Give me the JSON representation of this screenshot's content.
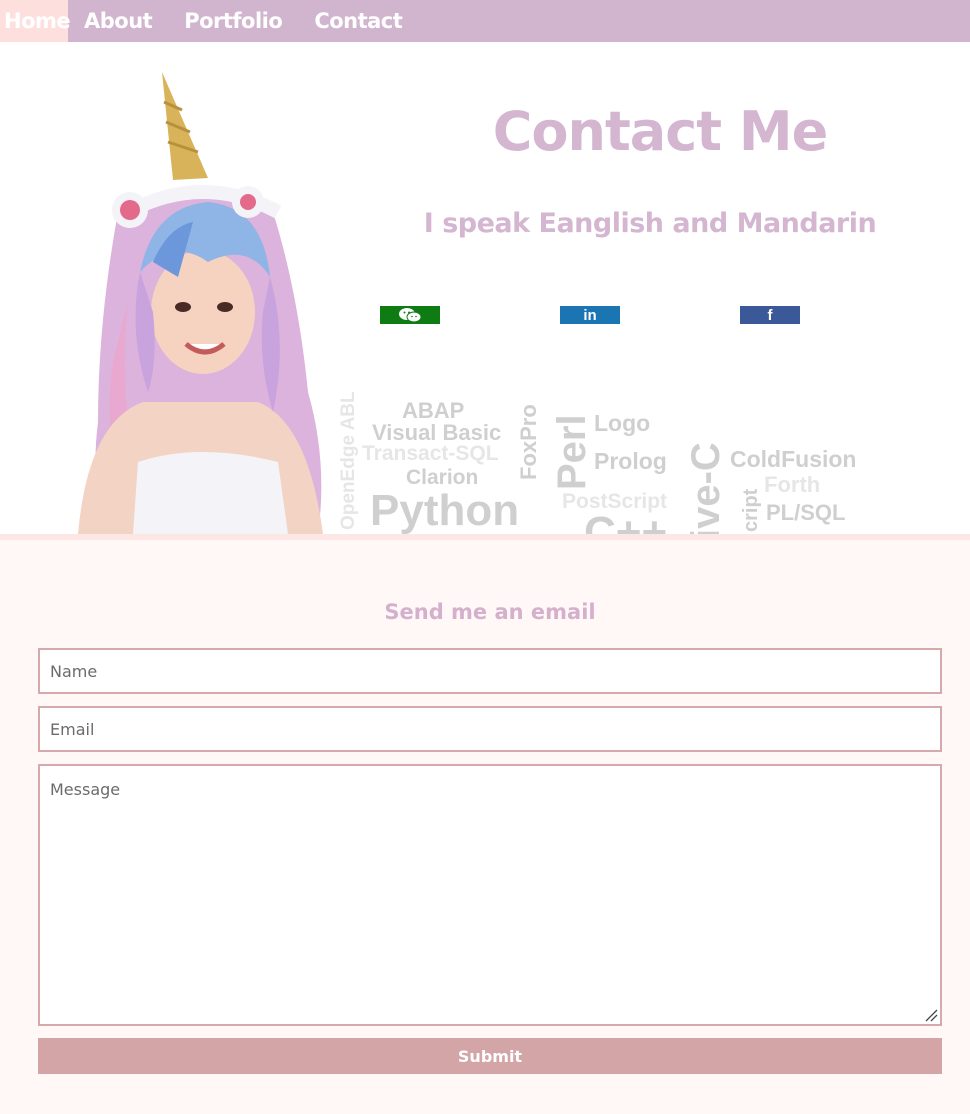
{
  "nav": {
    "items": [
      {
        "label": "Home",
        "active": true
      },
      {
        "label": "About",
        "active": false
      },
      {
        "label": "Portfolio",
        "active": false
      },
      {
        "label": "Contact",
        "active": false
      }
    ]
  },
  "hero": {
    "title": "Contact Me",
    "subtitle": "I speak Eanglish and Mandarin",
    "social": [
      {
        "name": "wechat-icon",
        "color": "#0f7c13"
      },
      {
        "name": "linkedin-icon",
        "glyph": "in",
        "color": "#1a75b2"
      },
      {
        "name": "facebook-icon",
        "glyph": "f",
        "color": "#3b5998"
      }
    ],
    "word_cloud": [
      "ABAP",
      "Visual Basic",
      "Transact-SQL",
      "Clarion",
      "Python",
      "FoxPro",
      "Perl",
      "Logo",
      "Prolog",
      "PostScript",
      "ive-C",
      "ColdFusion",
      "Forth",
      "PL/SQL",
      "OpenEdge ABL",
      "C++",
      "cript"
    ]
  },
  "form": {
    "title": "Send me an email",
    "name_placeholder": "Name",
    "email_placeholder": "Email",
    "message_placeholder": "Message",
    "submit_label": "Submit"
  },
  "colors": {
    "nav_bg": "#d1b5cf",
    "nav_active_bg": "#fde0de",
    "accent_text": "#d4b6d1",
    "field_border": "#d6a9ad",
    "submit_bg": "#d4a5a6"
  }
}
